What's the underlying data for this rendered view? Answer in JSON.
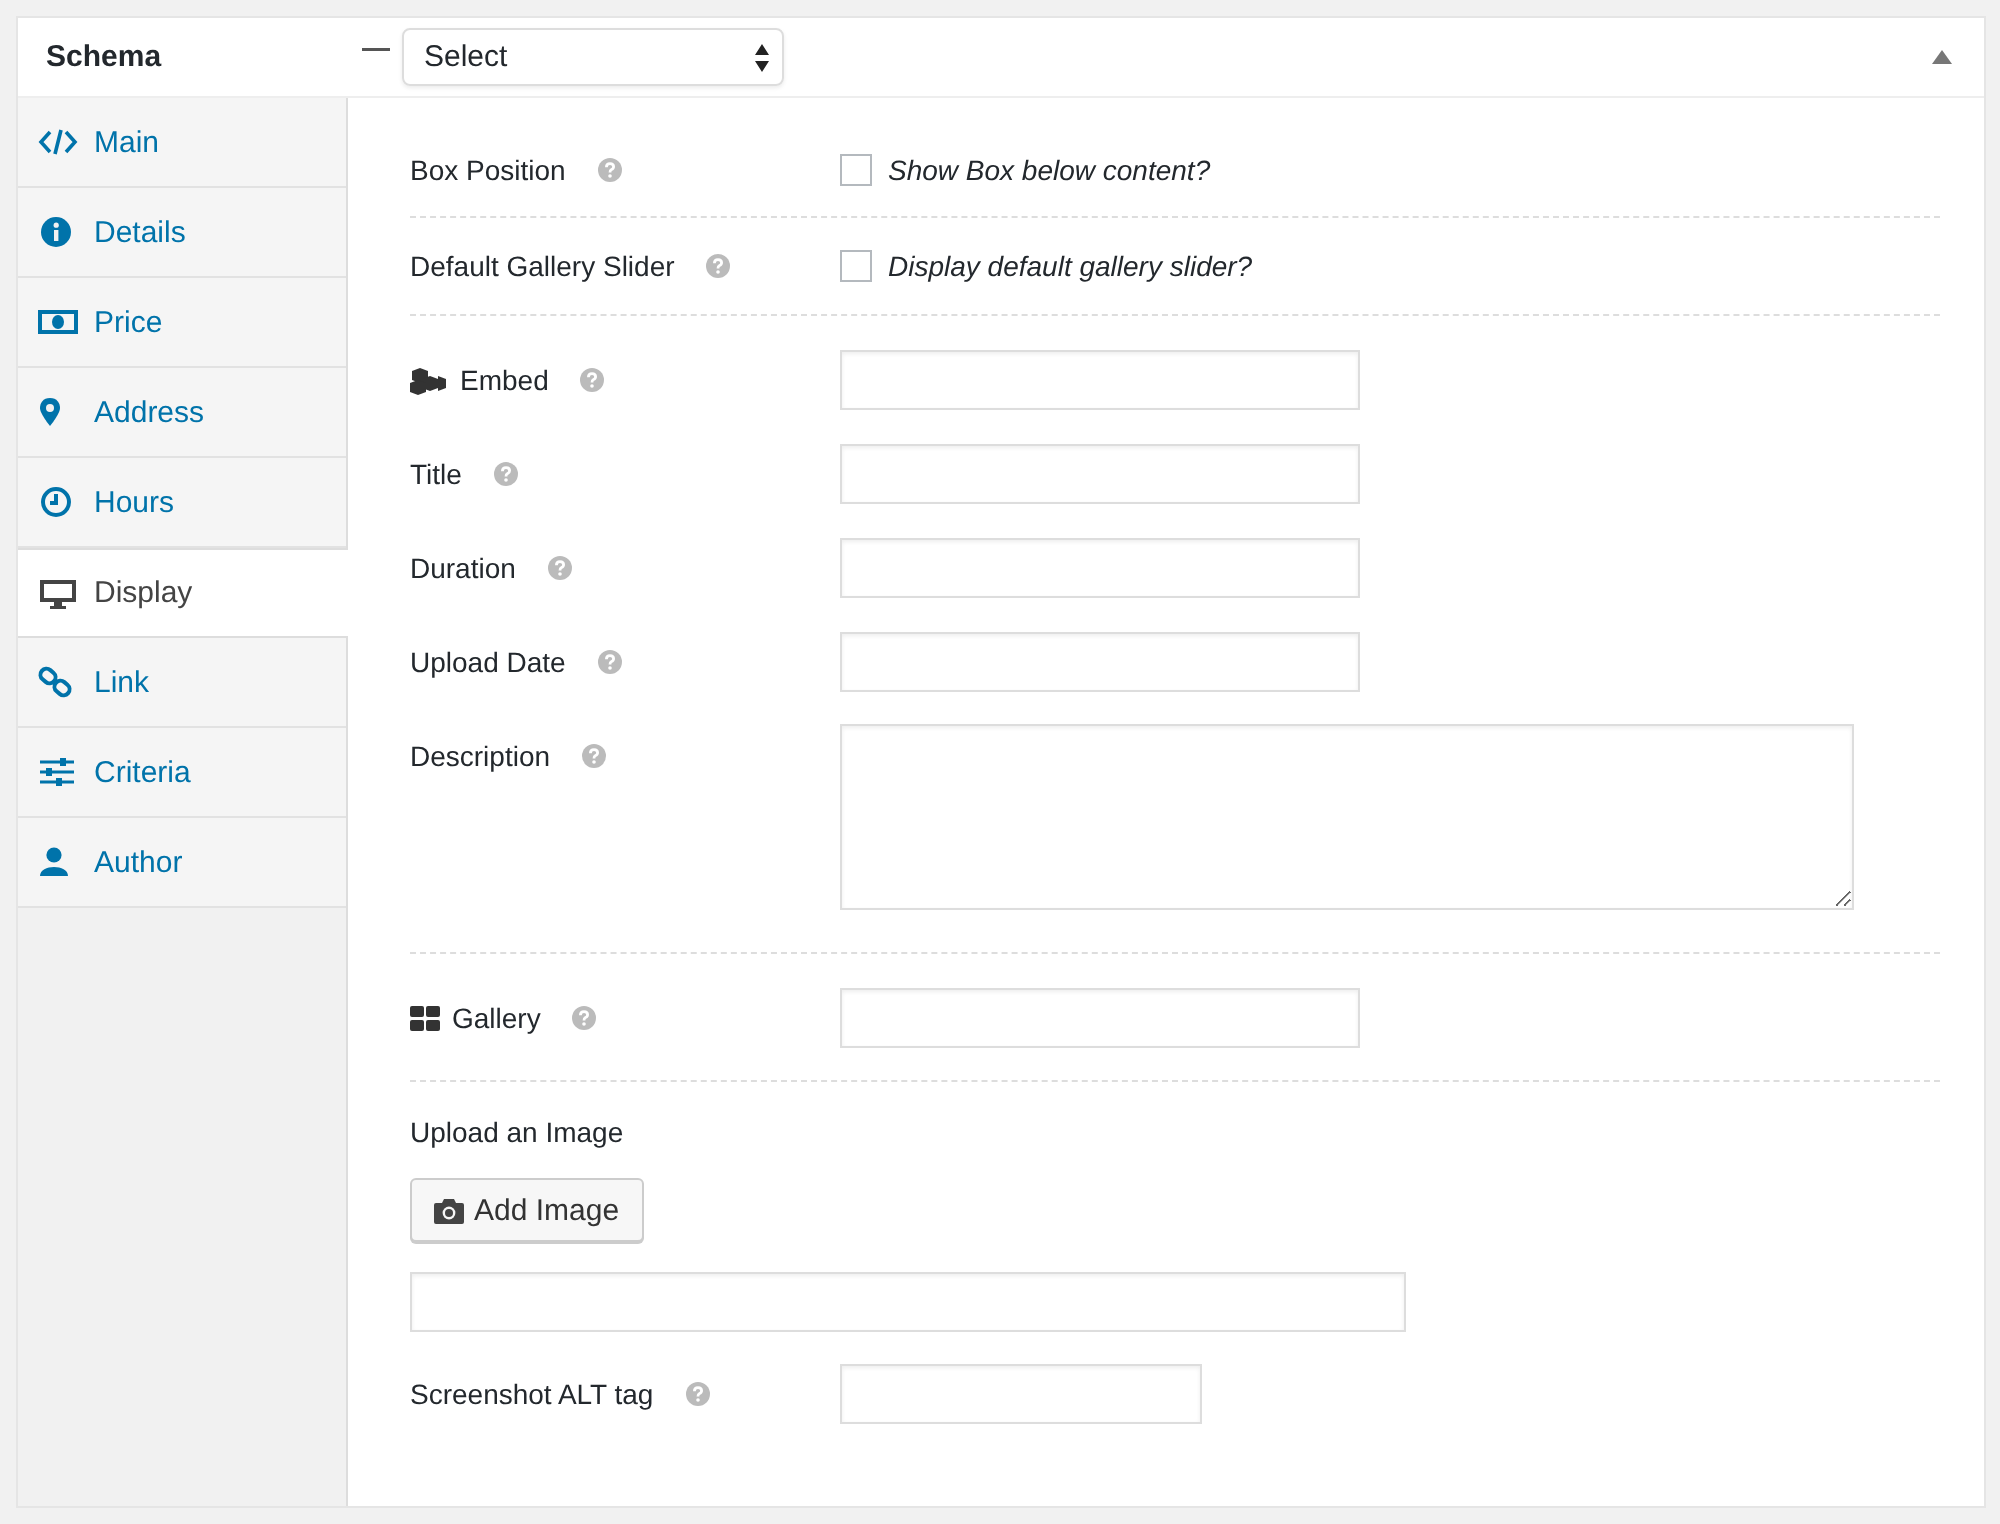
{
  "header": {
    "title": "Schema",
    "select": {
      "value": "Select"
    }
  },
  "tabs": [
    {
      "label": "Main",
      "selected": false
    },
    {
      "label": "Details",
      "selected": false
    },
    {
      "label": "Price",
      "selected": false
    },
    {
      "label": "Address",
      "selected": false
    },
    {
      "label": "Hours",
      "selected": false
    },
    {
      "label": "Display",
      "selected": true
    },
    {
      "label": "Link",
      "selected": false
    },
    {
      "label": "Criteria",
      "selected": false
    },
    {
      "label": "Author",
      "selected": false
    }
  ],
  "fields": [
    {
      "kind": "checkbox",
      "label": "Box Position",
      "help": true,
      "option": "Show Box below content?",
      "checked": false,
      "divider": true
    },
    {
      "kind": "checkbox",
      "label": "Default Gallery Slider",
      "help": true,
      "option": "Display default gallery slider?",
      "checked": false,
      "divider": true
    },
    {
      "kind": "text",
      "label": "Embed",
      "help": true
    },
    {
      "kind": "text",
      "label": "Title",
      "help": true
    },
    {
      "kind": "text",
      "label": "Duration",
      "help": true
    },
    {
      "kind": "text",
      "label": "Upload Date",
      "help": true
    },
    {
      "kind": "textarea",
      "label": "Description",
      "help": true,
      "divider": true
    },
    {
      "kind": "text",
      "label": "Gallery",
      "help": true,
      "divider": true
    },
    {
      "kind": "upload",
      "label": "Upload an Image",
      "button": "Add Image"
    },
    {
      "kind": "short-text",
      "label": "Screenshot ALT tag",
      "help": true
    }
  ]
}
